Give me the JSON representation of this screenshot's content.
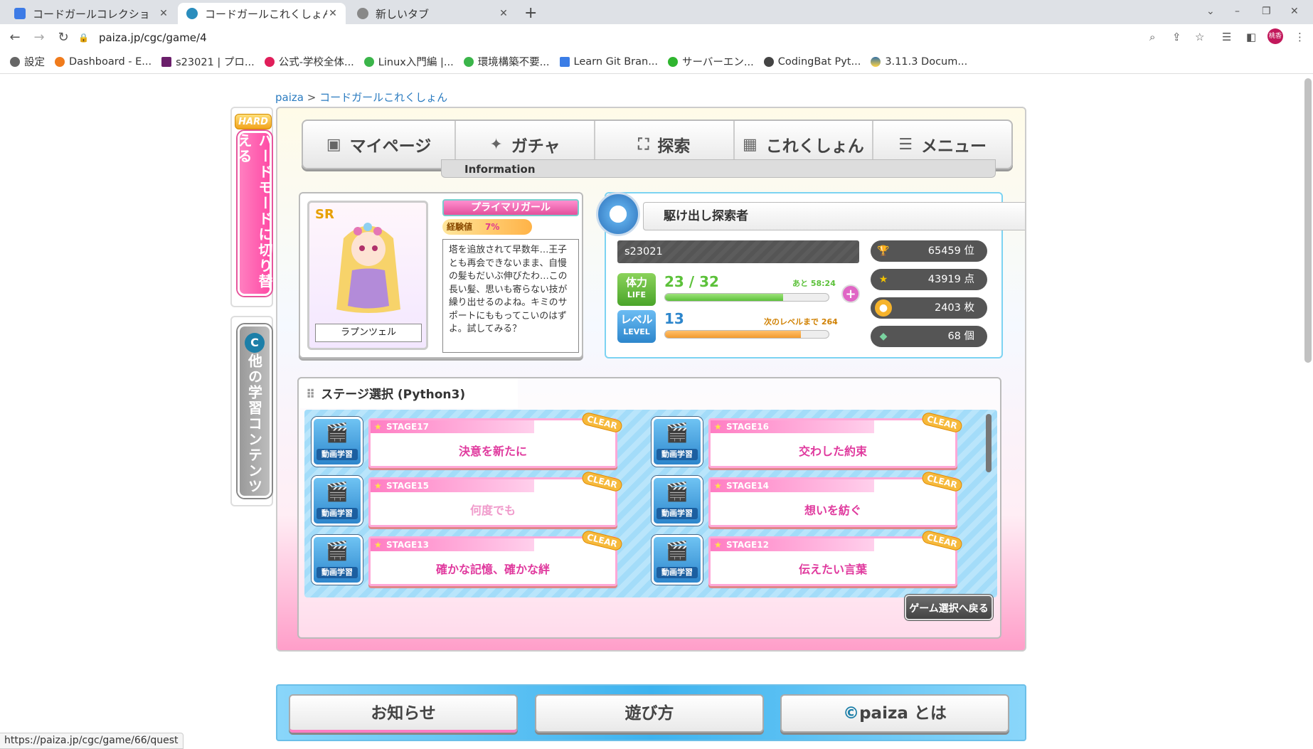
{
  "browser": {
    "tabs": [
      {
        "title": "コードガールコレクショ",
        "active": false
      },
      {
        "title": "コードガールこれくしょん",
        "active": true
      },
      {
        "title": "新しいタブ",
        "active": false
      }
    ],
    "url": "paiza.jp/cgc/game/4",
    "profile_label": "桃香",
    "bookmarks": [
      "設定",
      "Dashboard - E...",
      "s23021 | プロ...",
      "公式-学校全体...",
      "Linux入門編 |...",
      "環境構築不要...",
      "Learn Git Bran...",
      "サーバーエン...",
      "CodingBat Pyt...",
      "3.11.3 Docum..."
    ],
    "status_url": "https://paiza.jp/cgc/game/66/quest"
  },
  "breadcrumb": {
    "root": "paiza",
    "sep": ">",
    "current": "コードガールこれくしょん"
  },
  "side": {
    "hard_badge": "HARD",
    "hard_mode": "ハードモードに切り替える",
    "other": "他の学習コンテンツ"
  },
  "nav": {
    "items": [
      "マイページ",
      "ガチャ",
      "探索",
      "これくしょん",
      "メニュー"
    ],
    "info": "Information"
  },
  "character": {
    "rarity": "SR",
    "name": "ラプンツェル",
    "rank": "プライマリガール",
    "exp_label": "経験値",
    "exp_value": "7",
    "exp_unit": "%",
    "description": "塔を追放されて早数年…王子とも再会できないまま、自慢の髪もだいぶ伸びたわ…この長い髪、思いも寄らない技が繰り出せるのよね。キミのサポートにももってこいのはずよ。試してみる？"
  },
  "status": {
    "title": "駆け出し探索者",
    "username": "s23021",
    "life_label": "体力",
    "life_sub": "LIFE",
    "life_value": "23 / 32",
    "life_fraction": 0.72,
    "life_note": "あと 58:24",
    "level_label": "レベル",
    "level_sub": "LEVEL",
    "level_value": "13",
    "level_fraction": 0.83,
    "level_note": "次のレベルまで 264",
    "rank": "65459 位",
    "points": "43919 点",
    "coins": "2403 枚",
    "gems": "68 個"
  },
  "stages": {
    "title": "ステージ選択 (Python3)",
    "video_label": "動画学習",
    "clear_label": "CLEAR",
    "items": [
      {
        "num": "STAGE17",
        "name": "決意を新たに"
      },
      {
        "num": "STAGE16",
        "name": "交わした約束"
      },
      {
        "num": "STAGE15",
        "name": "何度でも"
      },
      {
        "num": "STAGE14",
        "name": "想いを紡ぐ"
      },
      {
        "num": "STAGE13",
        "name": "確かな記憶、確かな絆"
      },
      {
        "num": "STAGE12",
        "name": "伝えたい言葉"
      }
    ],
    "back": "ゲーム選択へ戻る"
  },
  "footer": {
    "news": "お知らせ",
    "howto": "遊び方",
    "about": "paiza とは"
  },
  "colors": {
    "accent_pink": "#e03a9e",
    "life_bar": "#5cc13a",
    "level_bar": "#f29a2e",
    "panel_blue": "#7cd3f2"
  }
}
